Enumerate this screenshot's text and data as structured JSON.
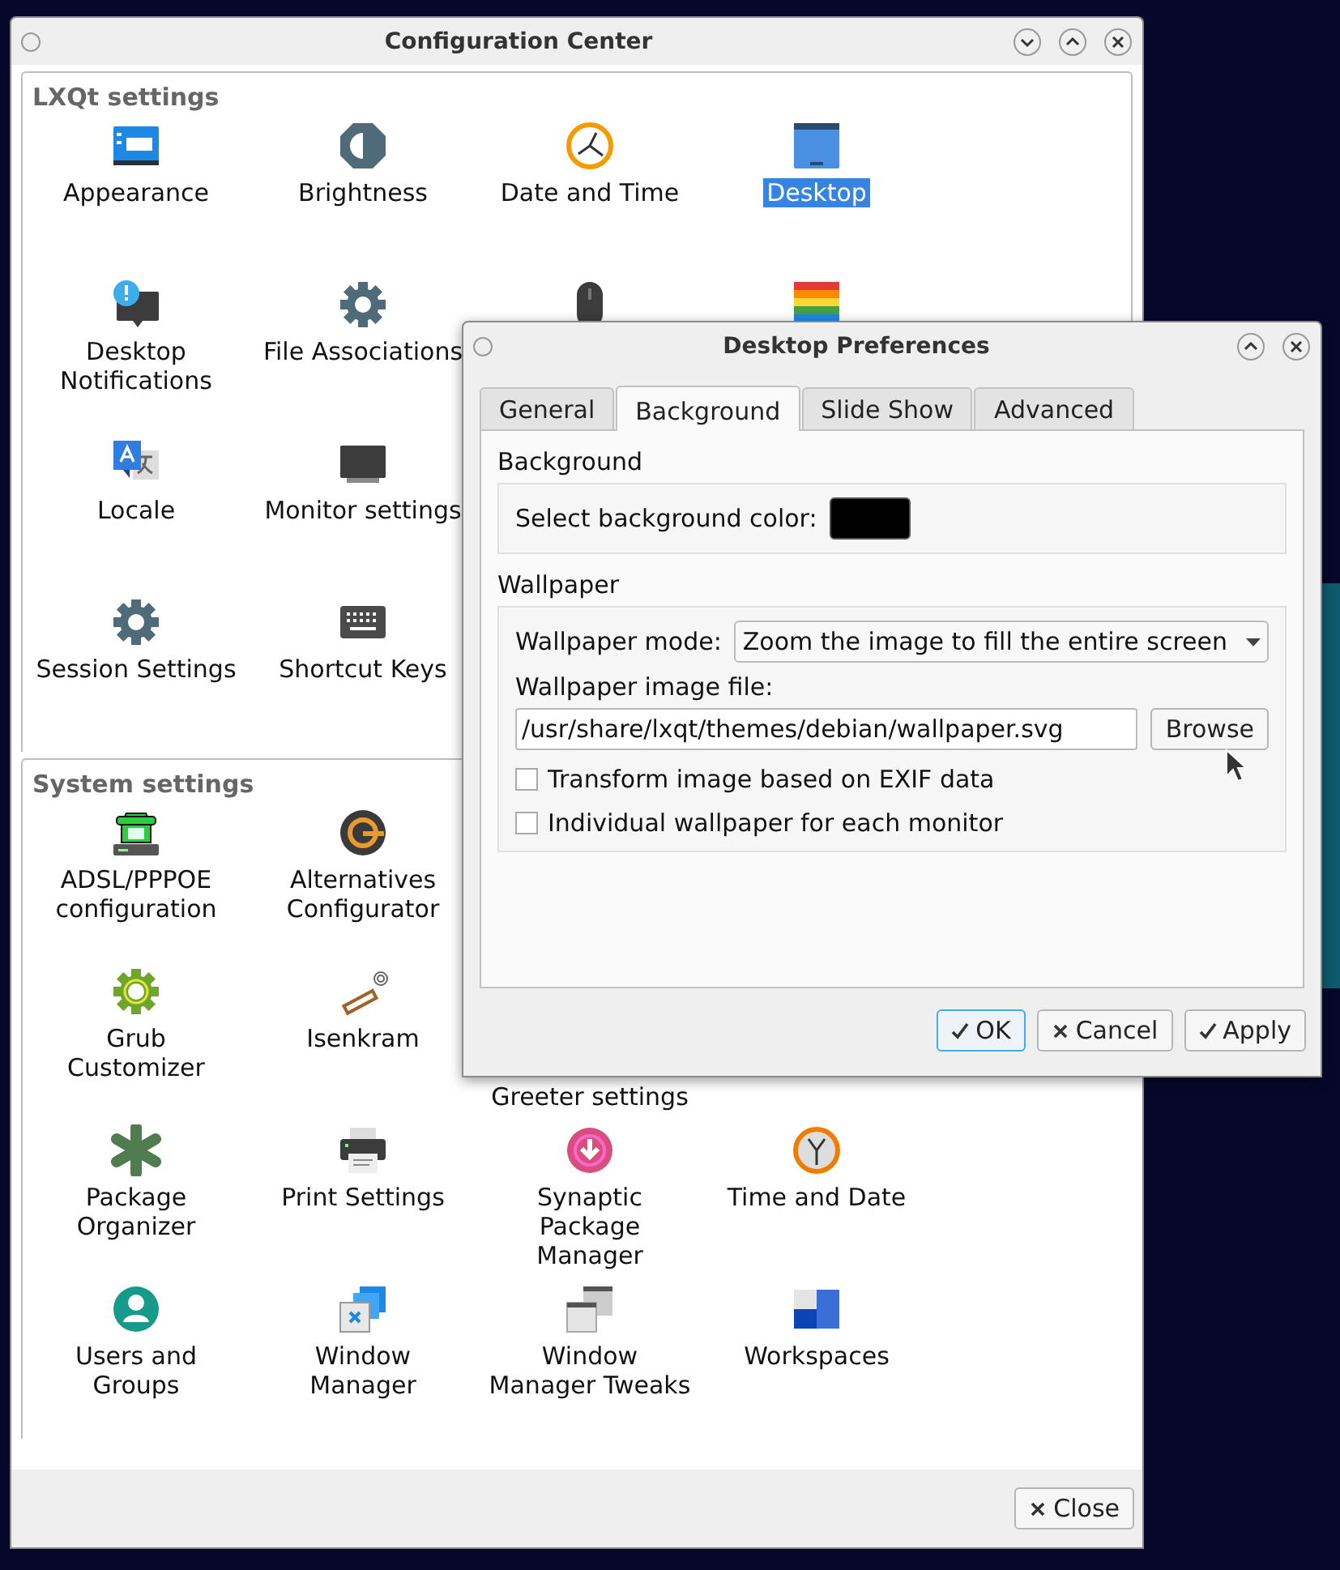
{
  "config_center": {
    "title": "Configuration Center",
    "sections": [
      {
        "title": "LXQt settings",
        "rows": [
          [
            {
              "label": "Appearance",
              "selected": false
            },
            {
              "label": "Brightness",
              "selected": false
            },
            {
              "label": "Date and Time",
              "selected": false
            },
            {
              "label": "Desktop",
              "selected": true
            }
          ],
          [
            {
              "label": "Desktop\nNotifications",
              "selected": false
            },
            {
              "label": "File Associations",
              "selected": false
            },
            {
              "selected": false
            },
            {
              "selected": false
            }
          ],
          [
            {
              "label": "Locale",
              "selected": false
            },
            {
              "label": "Monitor settings",
              "selected": false
            }
          ],
          [
            {
              "label": "Session Settings",
              "selected": false
            },
            {
              "label": "Shortcut Keys",
              "selected": false
            }
          ]
        ]
      },
      {
        "title": "System settings",
        "rows": [
          [
            {
              "label": "ADSL/PPPOE\nconfiguration",
              "selected": false
            },
            {
              "label": "Alternatives\nConfigurator",
              "selected": false
            }
          ],
          [
            {
              "label": "Grub\nCustomizer",
              "selected": false
            },
            {
              "label": "Isenkram",
              "selected": false
            },
            {
              "label": "Greeter settings",
              "selected": false,
              "kind": "covered"
            }
          ],
          [
            {
              "label": "Package\nOrganizer",
              "selected": false
            },
            {
              "label": "Print Settings",
              "selected": false
            },
            {
              "label": "Synaptic\nPackage\nManager",
              "selected": false
            },
            {
              "label": "Time and Date",
              "selected": false
            }
          ],
          [
            {
              "label": "Users and\nGroups",
              "selected": false
            },
            {
              "label": "Window\nManager",
              "selected": false
            },
            {
              "label": "Window\nManager Tweaks",
              "selected": false
            },
            {
              "label": "Workspaces",
              "selected": false
            }
          ]
        ]
      }
    ],
    "close_button": "Close"
  },
  "dialog": {
    "title": "Desktop Preferences",
    "tabs": [
      {
        "label": "General",
        "selected": false
      },
      {
        "label": "Background",
        "selected": true
      },
      {
        "label": "Slide Show",
        "selected": false
      },
      {
        "label": "Advanced",
        "selected": false
      }
    ],
    "background_group": {
      "title": "Background",
      "color_label": "Select background color:",
      "color": "#000000"
    },
    "wallpaper_group": {
      "title": "Wallpaper",
      "mode_label": "Wallpaper mode:",
      "mode_value": "Zoom the image to fill the entire screen",
      "file_label": "Wallpaper image file:",
      "file_value": "/usr/share/lxqt/themes/debian/wallpaper.svg",
      "browse_button": "Browse",
      "checkboxes": [
        {
          "label": "Transform image based on EXIF data",
          "checked": false
        },
        {
          "label": "Individual wallpaper for each monitor",
          "checked": false
        }
      ]
    },
    "buttons": [
      {
        "label": "OK",
        "kind": "accept",
        "default": true
      },
      {
        "label": "Cancel",
        "kind": "reject",
        "default": false
      },
      {
        "label": "Apply",
        "kind": "accept",
        "default": false
      }
    ]
  }
}
